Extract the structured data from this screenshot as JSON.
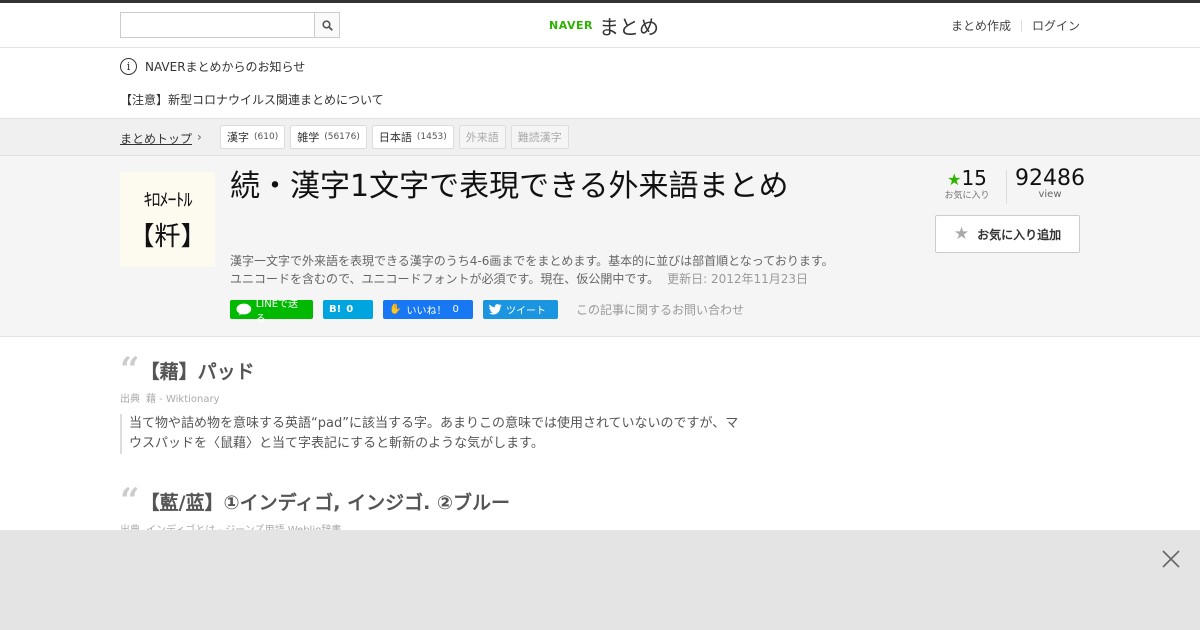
{
  "header": {
    "search_placeholder": "",
    "logo_naver": "NAVER",
    "logo_matome": "まとめ",
    "create_link": "まとめ作成",
    "login_link": "ログイン"
  },
  "notices": {
    "info": "NAVERまとめからのお知らせ",
    "corona": "【注意】新型コロナウイルス関連まとめについて"
  },
  "breadcrumb": {
    "top": "まとめトップ",
    "tags": [
      {
        "label": "漢字",
        "count": "(610)"
      },
      {
        "label": "雑学",
        "count": "(56176)"
      },
      {
        "label": "日本語",
        "count": "(1453)"
      },
      {
        "label": "外来語",
        "count": ""
      },
      {
        "label": "難読漢字",
        "count": ""
      }
    ]
  },
  "article": {
    "thumb_line1": "ｷﾛﾒｰﾄﾙ",
    "thumb_line2": "【粁】",
    "title": "続・漢字1文字で表現できる外来語まとめ",
    "desc_line1": "漢字一文字で外来語を表現できる漢字のうち4-6画までをまとめます。基本的に並びは部首順となっております。",
    "desc_line2": "ユニコードを含むので、ユニコードフォントが必須です。現在、仮公開中です。",
    "updated": "更新日: 2012年11月23日",
    "fav_count": "15",
    "fav_label": "お気に入り",
    "view_count": "92486",
    "view_label": "view",
    "fav_button": "お気に入り追加"
  },
  "share": {
    "line": "LINEで送る",
    "hatena_count": "0",
    "fb_label": "いいね！",
    "fb_count": "0",
    "tweet": "ツイート",
    "inquiry": "この記事に関するお問い合わせ"
  },
  "items": [
    {
      "heading": "【藉】パッド",
      "source_label": "出典",
      "source": "藉 - Wiktionary",
      "quote": "当て物や詰め物を意味する英語“pad”に該当する字。あまりこの意味では使用されていないのですが、マウスパッドを〈鼠藉〉と当て字表記にすると斬新のような気がします。"
    },
    {
      "heading": "【藍/蓝】①インディゴ, インジゴ. ②ブルー",
      "source_label": "出典",
      "source": "インディゴとは - ジーンズ用語 Weblio辞書"
    }
  ],
  "colors": {
    "accent": "#2db400",
    "line": "#00b900",
    "hatena": "#00a4de",
    "facebook": "#1877f2",
    "twitter": "#1b95e0"
  }
}
